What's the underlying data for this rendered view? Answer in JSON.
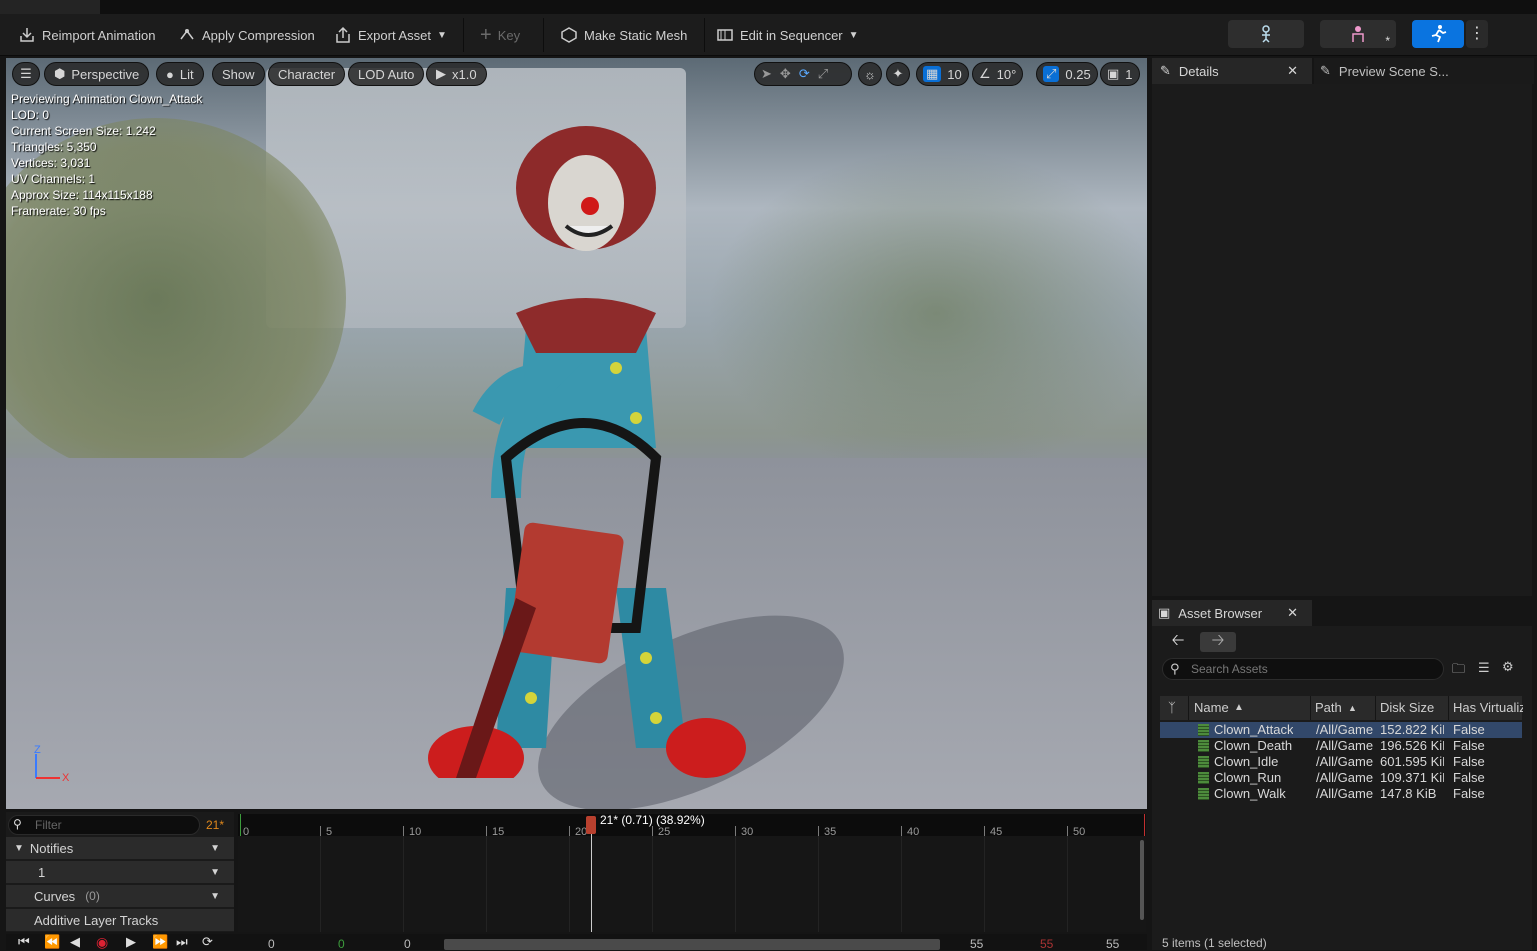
{
  "toolbar": {
    "reimport": "Reimport Animation",
    "apply_compression": "Apply Compression",
    "export_asset": "Export Asset",
    "key": "Key",
    "make_static_mesh": "Make Static Mesh",
    "edit_in_sequencer": "Edit in Sequencer"
  },
  "viewport": {
    "perspective": "Perspective",
    "lit": "Lit",
    "show": "Show",
    "character": "Character",
    "lod": "LOD Auto",
    "speed": "x1.0",
    "grid_value": "10",
    "angle_value": "10°",
    "scale_value": "0.25",
    "camera_speed": "1",
    "stats": [
      "Previewing Animation Clown_Attack",
      "LOD: 0",
      "Current Screen Size: 1.242",
      "Triangles: 5,350",
      "Vertices: 3,031",
      "UV Channels: 1",
      "Approx Size: 114x115x188",
      "Framerate: 30 fps"
    ],
    "axis_z": "Z",
    "axis_x": "X"
  },
  "details": {
    "tab": "Details",
    "preview_tab": "Preview Scene S..."
  },
  "asset_browser": {
    "tab": "Asset Browser",
    "search_placeholder": "Search Assets",
    "columns": [
      "Name",
      "Path",
      "Disk Size",
      "Has Virtualiz"
    ],
    "rows": [
      {
        "name": "Clown_Attack",
        "path": "/All/Game",
        "size": "152.822 KiB",
        "virt": "False",
        "selected": true
      },
      {
        "name": "Clown_Death",
        "path": "/All/Game",
        "size": "196.526 KiB",
        "virt": "False"
      },
      {
        "name": "Clown_Idle",
        "path": "/All/Game",
        "size": "601.595 KiB",
        "virt": "False"
      },
      {
        "name": "Clown_Run",
        "path": "/All/Game",
        "size": "109.371 KiB",
        "virt": "False"
      },
      {
        "name": "Clown_Walk",
        "path": "/All/Game",
        "size": "147.8 KiB",
        "virt": "False"
      }
    ],
    "status": "5 items (1 selected)"
  },
  "timeline": {
    "filter_placeholder": "Filter",
    "frame_badge": "21*",
    "notifies": "Notifies",
    "notify_track": "1",
    "curves": "Curves",
    "curves_count": "(0)",
    "additive": "Additive Layer Tracks",
    "playhead_label": "21* (0.71) (38.92%)",
    "ticks": [
      "0",
      "5",
      "10",
      "15",
      "20",
      "25",
      "30",
      "35",
      "40",
      "45",
      "50"
    ],
    "transport_values": [
      "0",
      "0",
      "0",
      "55",
      "55",
      "55"
    ]
  }
}
